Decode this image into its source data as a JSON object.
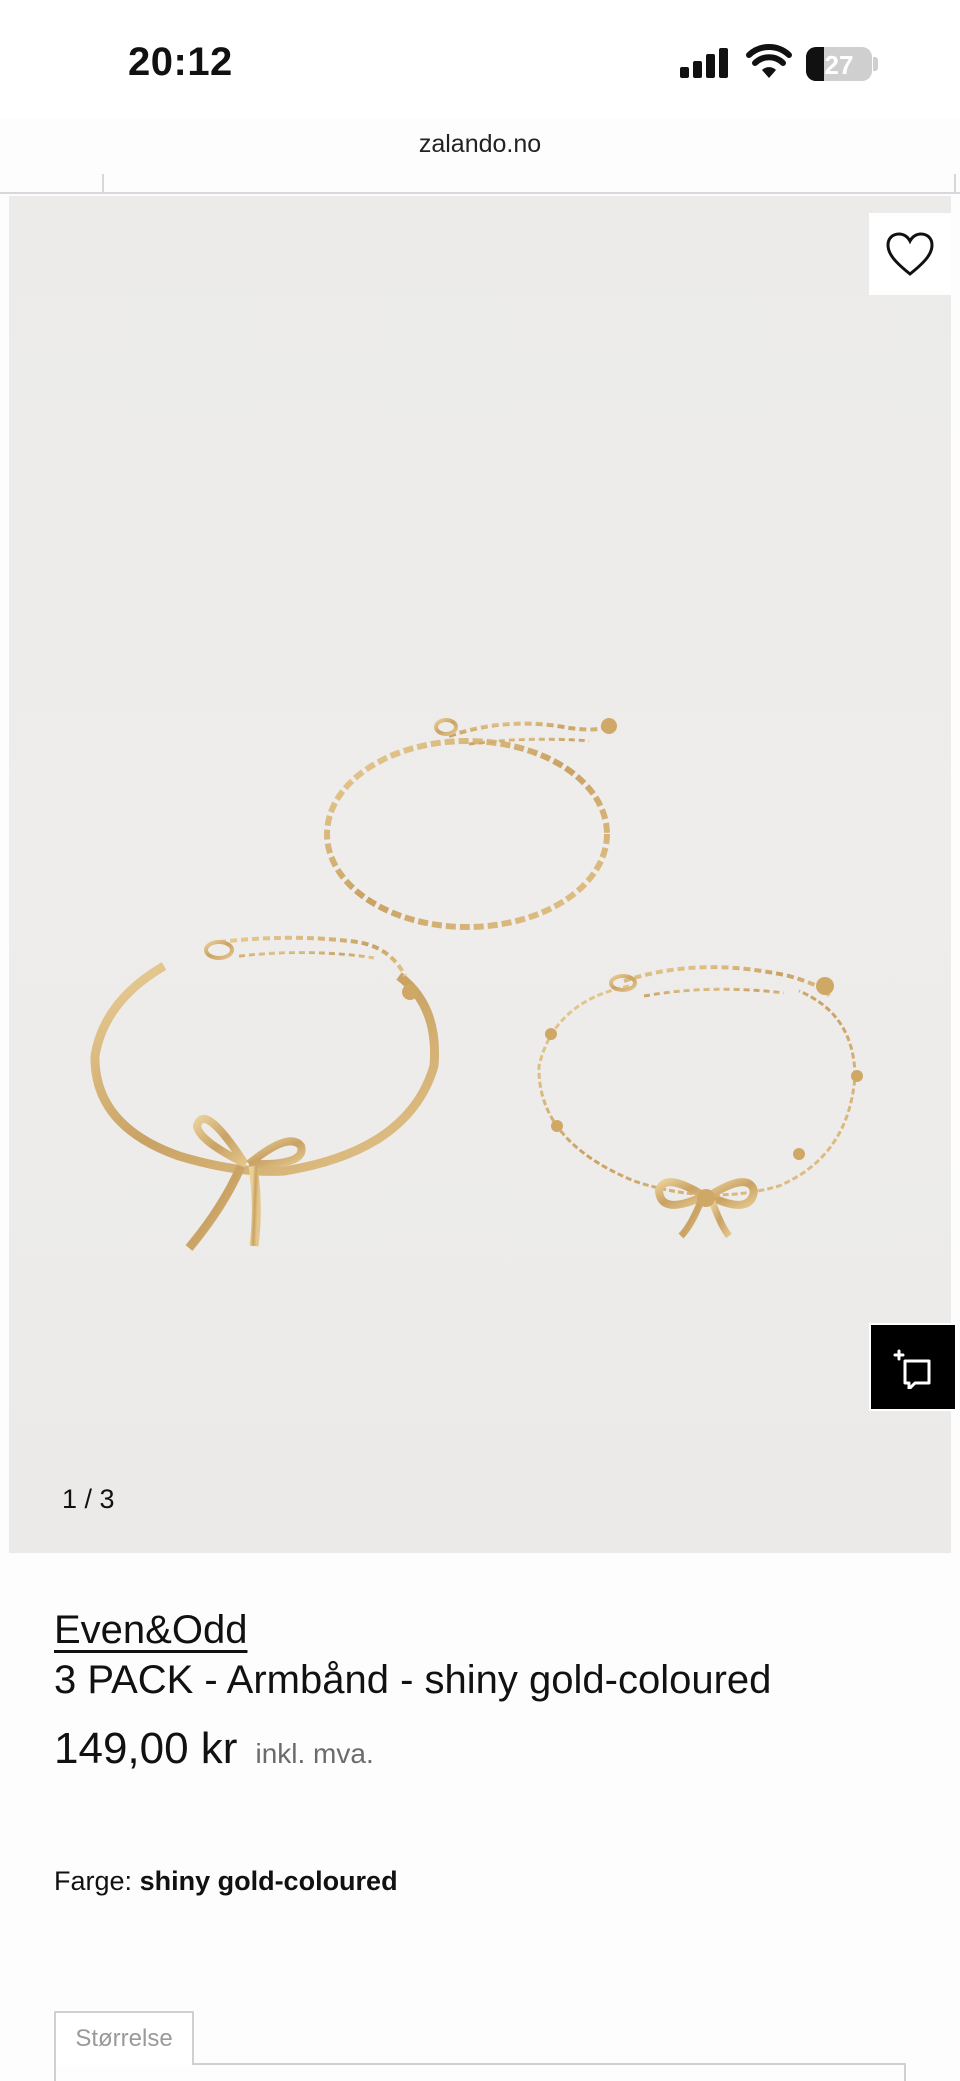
{
  "status_bar": {
    "time": "20:12",
    "battery_percent": "27",
    "battery_level": 0.27,
    "icons": [
      "signal-icon",
      "wifi-icon",
      "battery-icon"
    ]
  },
  "browser": {
    "url": "zalando.no"
  },
  "gallery": {
    "counter": "1 / 3",
    "wishlist_icon": "heart-icon",
    "similar_icon": "find-similar-icon"
  },
  "product": {
    "brand": "Even&Odd",
    "name": "3 PACK - Armbånd - shiny gold-coloured",
    "price": "149,00 kr",
    "vat_note": "inkl. mva.",
    "color_label": "Farge:",
    "color_value": "shiny gold-coloured",
    "size_label": "Størrelse"
  },
  "colors": {
    "gold": "#d9b77a",
    "image_bg": "#ecebe9"
  }
}
